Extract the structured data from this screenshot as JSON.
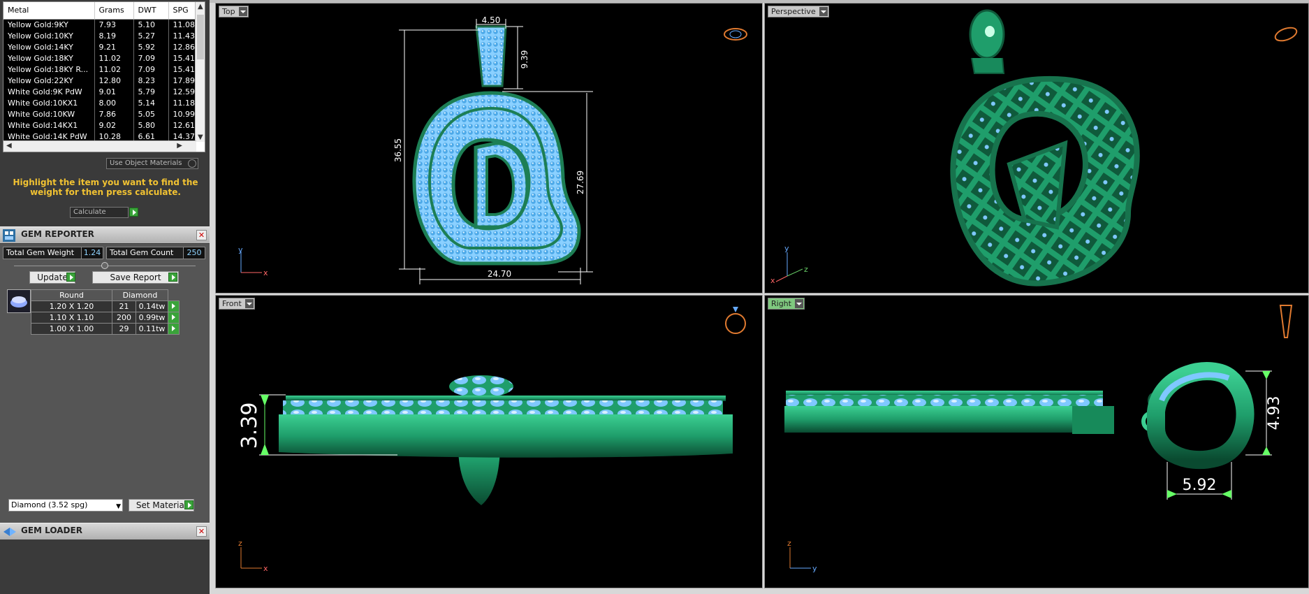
{
  "metal_table": {
    "headers": [
      "Metal",
      "Grams",
      "DWT",
      "SPG"
    ],
    "rows": [
      [
        "Yellow Gold:9KY",
        "7.93",
        "5.10",
        "11.08"
      ],
      [
        "Yellow Gold:10KY",
        "8.19",
        "5.27",
        "11.43"
      ],
      [
        "Yellow Gold:14KY",
        "9.21",
        "5.92",
        "12.86"
      ],
      [
        "Yellow Gold:18KY",
        "11.02",
        "7.09",
        "15.41"
      ],
      [
        "Yellow Gold:18KY R...",
        "11.02",
        "7.09",
        "15.41"
      ],
      [
        "Yellow Gold:22KY",
        "12.80",
        "8.23",
        "17.89"
      ],
      [
        "White Gold:9K PdW",
        "9.01",
        "5.79",
        "12.59"
      ],
      [
        "White Gold:10KX1",
        "8.00",
        "5.14",
        "11.18"
      ],
      [
        "White Gold:10KW",
        "7.86",
        "5.05",
        "10.99"
      ],
      [
        "White Gold:14KX1",
        "9.02",
        "5.80",
        "12.61"
      ],
      [
        "White Gold:14K PdW",
        "10.28",
        "6.61",
        "14.37"
      ]
    ]
  },
  "use_object_materials": "Use Object Materials",
  "hint": "Highlight the item you want to find the weight for then press calculate.",
  "calculate_label": "Calculate",
  "gem_reporter": {
    "title": "GEM REPORTER",
    "total_weight_label": "Total Gem Weight",
    "total_weight": "1.24",
    "total_count_label": "Total Gem Count",
    "total_count": "250",
    "update_label": "Update",
    "save_report_label": "Save Report",
    "columns": [
      "Round",
      "Diamond"
    ],
    "gems": [
      [
        "1.20 X 1.20",
        "21",
        "0.14tw"
      ],
      [
        "1.10 X 1.10",
        "200",
        "0.99tw"
      ],
      [
        "1.00 X 1.00",
        "29",
        "0.11tw"
      ]
    ],
    "material_select": "Diamond    (3.52 spg)",
    "set_material_label": "Set Material"
  },
  "gem_loader": {
    "title": "GEM LOADER"
  },
  "viewports": {
    "top": {
      "label": "Top",
      "dims": {
        "bail_width": "4.50",
        "bail_height": "9.39",
        "total_height": "36.55",
        "body_height": "27.69",
        "width": "24.70"
      },
      "axes": [
        "y",
        "x"
      ]
    },
    "perspective": {
      "label": "Perspective",
      "axes": [
        "y",
        "z",
        "x"
      ]
    },
    "front": {
      "label": "Front",
      "dims": {
        "height": "3.39"
      },
      "axes": [
        "z",
        "x"
      ]
    },
    "right": {
      "label": "Right",
      "dims": {
        "bail_height": "4.93",
        "bail_depth": "5.92"
      },
      "axes": [
        "z",
        "y"
      ]
    }
  },
  "colors": {
    "metal": "#1f9e6b",
    "gem": "#7fc8ff",
    "hint": "#f1c232",
    "tab_active": "#7fc97f"
  }
}
